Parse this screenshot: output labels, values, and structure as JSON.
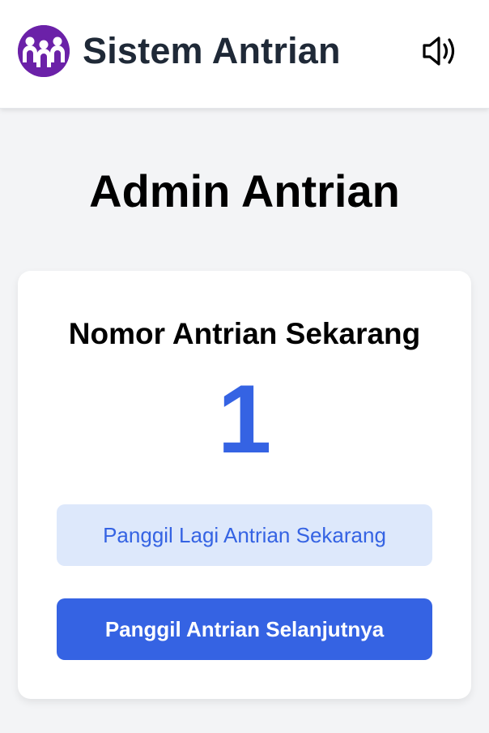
{
  "header": {
    "app_title": "Sistem Antrian",
    "logo_icon": "people-queue-icon",
    "sound_icon": "speaker-volume-icon",
    "brand_color": "#6b21a8"
  },
  "main": {
    "page_title": "Admin Antrian",
    "card": {
      "label": "Nomor Antrian Sekarang",
      "current_number": "1",
      "recall_button_label": "Panggil Lagi Antrian Sekarang",
      "next_button_label": "Panggil Antrian Selanjutnya"
    }
  },
  "colors": {
    "accent": "#3563e3",
    "accent_light": "#dde8fb",
    "page_background": "#f3f4f6"
  }
}
